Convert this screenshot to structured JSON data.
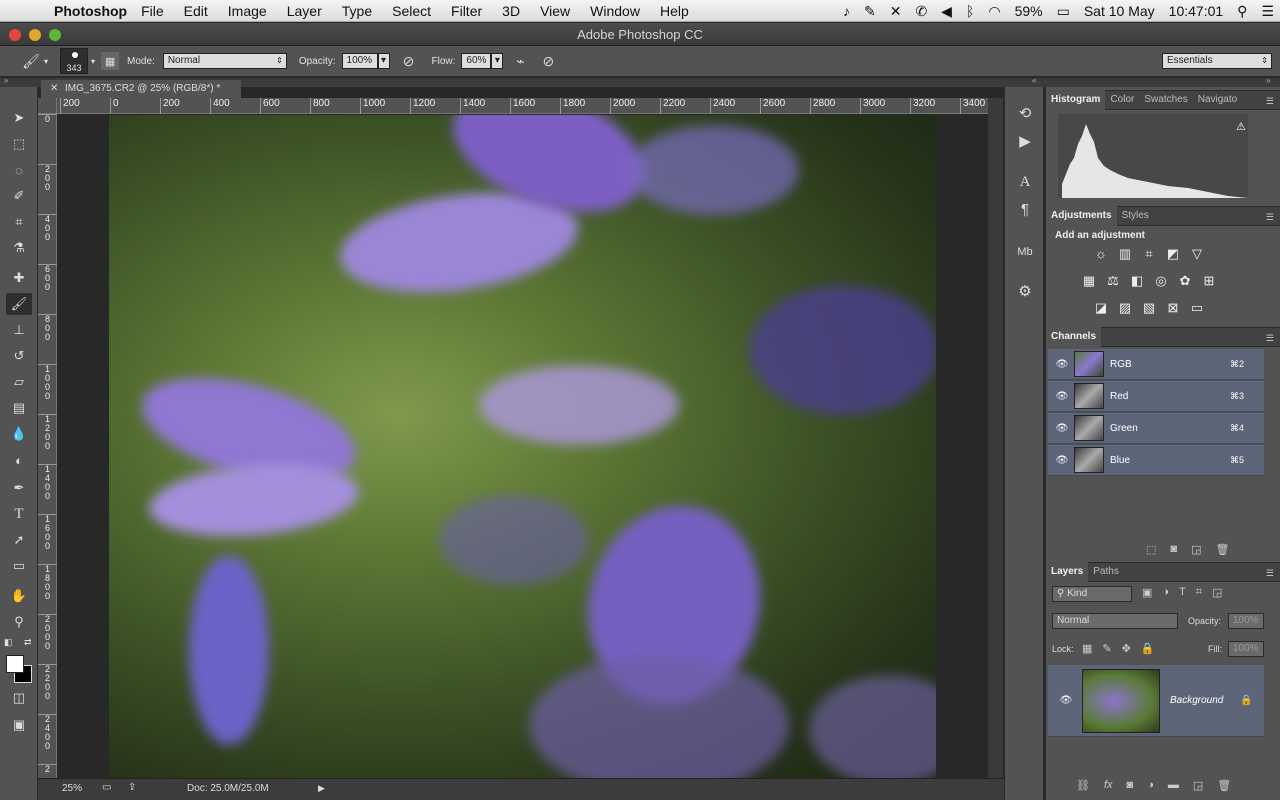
{
  "menubar": {
    "app_name": "Photoshop",
    "items": [
      "File",
      "Edit",
      "Image",
      "Layer",
      "Type",
      "Select",
      "Filter",
      "3D",
      "View",
      "Window",
      "Help"
    ],
    "battery": "59%",
    "date": "Sat 10 May",
    "time": "10:47:01"
  },
  "window": {
    "title": "Adobe Photoshop CC"
  },
  "options": {
    "brush_size": "343",
    "mode_label": "Mode:",
    "mode_value": "Normal",
    "opacity_label": "Opacity:",
    "opacity_value": "100%",
    "flow_label": "Flow:",
    "flow_value": "60%",
    "workspace": "Essentials"
  },
  "document": {
    "tab_title": "IMG_3675.CR2 @ 25% (RGB/8*) *",
    "zoom": "25%",
    "doc_size": "Doc: 25.0M/25.0M"
  },
  "rulers": {
    "h_ticks": [
      "200",
      "0",
      "200",
      "400",
      "600",
      "800",
      "1000",
      "1200",
      "1400",
      "1600",
      "1800",
      "2000",
      "2200",
      "2400",
      "2600",
      "2800",
      "3000",
      "3200",
      "3400"
    ],
    "v_ticks": [
      "0",
      "2 0 0",
      "4 0 0",
      "6 0 0",
      "8 0 0",
      "1 0 0 0",
      "1 2 0 0",
      "1 4 0 0",
      "1 6 0 0",
      "1 8 0 0",
      "2 0 0 0",
      "2 2 0 0",
      "2 4 0 0",
      "2"
    ]
  },
  "panels": {
    "top_tabs": [
      "Histogram",
      "Color",
      "Swatches",
      "Navigato"
    ],
    "adj_tabs": [
      "Adjustments",
      "Styles"
    ],
    "add_adjustment": "Add an adjustment",
    "channels_title": "Channels",
    "channels": [
      {
        "name": "RGB",
        "shortcut": "⌘2"
      },
      {
        "name": "Red",
        "shortcut": "⌘3"
      },
      {
        "name": "Green",
        "shortcut": "⌘4"
      },
      {
        "name": "Blue",
        "shortcut": "⌘5"
      }
    ],
    "layers_tabs": [
      "Layers",
      "Paths"
    ],
    "kind": "Kind",
    "blend_mode": "Normal",
    "opacity_label": "Opacity:",
    "opacity_value": "100%",
    "lock_label": "Lock:",
    "fill_label": "Fill:",
    "fill_value": "100%",
    "layer_name": "Background"
  },
  "colors": {
    "accent_selected": "#5d6678",
    "ui_gray": "#535353"
  }
}
